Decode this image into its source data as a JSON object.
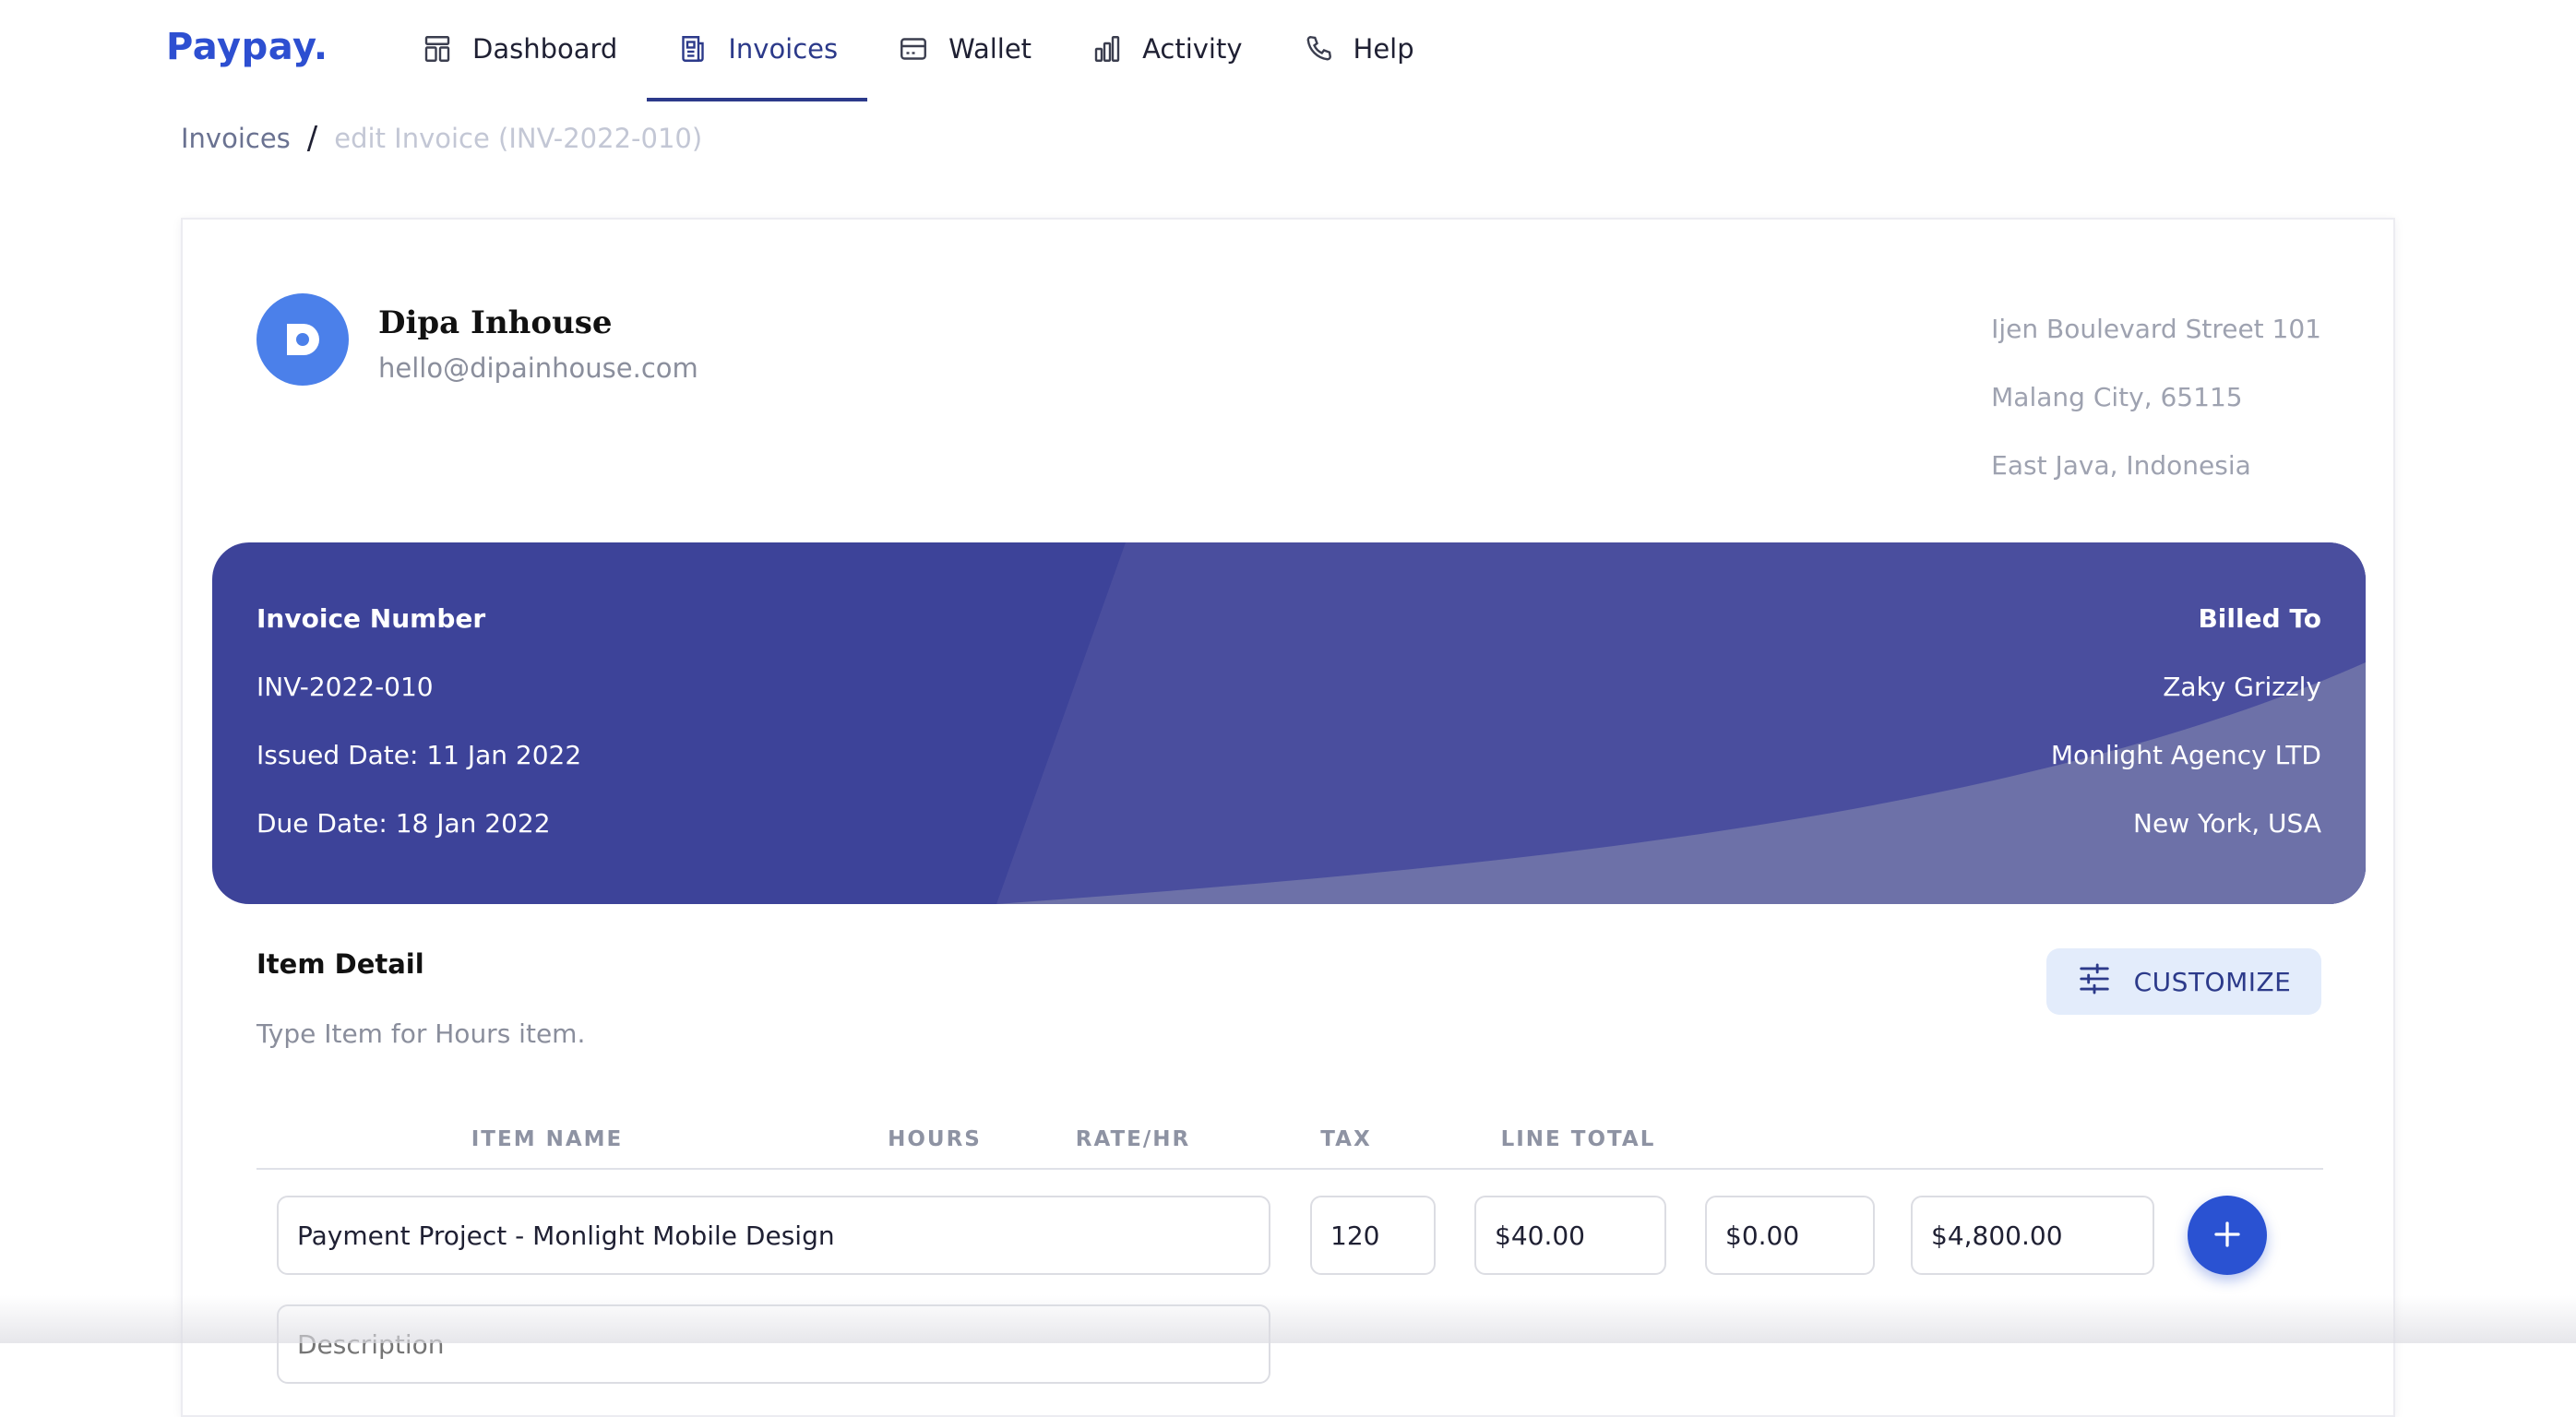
{
  "brand": {
    "logo_text": "Paypay.",
    "accent": "#2d4fd1"
  },
  "nav": {
    "items": [
      {
        "label": "Dashboard",
        "icon": "dashboard-icon",
        "active": false
      },
      {
        "label": "Invoices",
        "icon": "invoice-icon",
        "active": true
      },
      {
        "label": "Wallet",
        "icon": "wallet-icon",
        "active": false
      },
      {
        "label": "Activity",
        "icon": "activity-chart-icon",
        "active": false
      },
      {
        "label": "Help",
        "icon": "phone-icon",
        "active": false
      }
    ]
  },
  "breadcrumb": {
    "parent": "Invoices",
    "separator": "/",
    "current": "edit Invoice (INV-2022-010)"
  },
  "company": {
    "name": "Dipa Inhouse",
    "email": "hello@dipainhouse.com",
    "address_line1": "Ijen Boulevard Street 101",
    "address_line2": "Malang City, 65115",
    "address_line3": "East Java, Indonesia"
  },
  "invoice": {
    "number_label": "Invoice Number",
    "number": "INV-2022-010",
    "issued": "Issued Date: 11 Jan 2022",
    "due": "Due Date: 18 Jan 2022",
    "billed_to_label": "Billed To",
    "client_name": "Zaky Grizzly",
    "client_company": "Monlight Agency LTD",
    "client_location": "New York, USA",
    "banner_color": "#3d4399"
  },
  "items_section": {
    "title": "Item Detail",
    "subtitle": "Type Item for Hours item.",
    "customize_label": "CUSTOMIZE"
  },
  "table": {
    "headers": {
      "item_name": "ITEM NAME",
      "hours": "HOURS",
      "rate": "RATE/HR",
      "tax": "TAX",
      "line_total": "LINE TOTAL"
    },
    "row": {
      "item_name": "Payment Project - Monlight Mobile Design",
      "hours": "120",
      "rate": "$40.00",
      "tax": "$0.00",
      "line_total": "$4,800.00",
      "description_placeholder": "Description"
    }
  }
}
